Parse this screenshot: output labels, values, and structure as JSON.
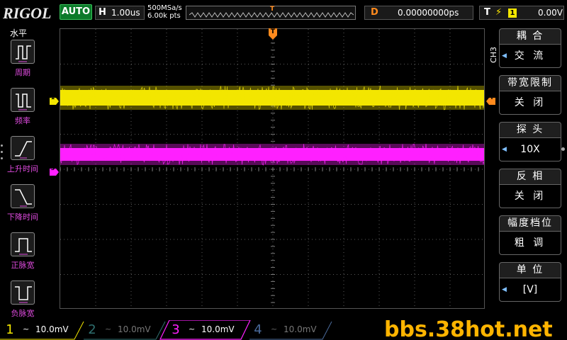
{
  "topbar": {
    "brand": "RIGOL",
    "run_mode": "AUTO",
    "horizontal": {
      "label": "H",
      "value": "1.00us"
    },
    "sample": {
      "rate": "500MSa/s",
      "points": "6.00k pts"
    },
    "memory_trigger_marker": "T",
    "delay": {
      "label": "D",
      "value": "0.00000000ps"
    },
    "trigger": {
      "label": "T",
      "edge_icon": "rising-edge-icon",
      "source": "1",
      "level": "0.00V"
    }
  },
  "left_menu": {
    "title": "水平",
    "items": [
      {
        "label": "周期",
        "icon": "period-measure-icon"
      },
      {
        "label": "频率",
        "icon": "frequency-measure-icon"
      },
      {
        "label": "上升时间",
        "icon": "rise-time-icon"
      },
      {
        "label": "下降时间",
        "icon": "fall-time-icon"
      },
      {
        "label": "正脉宽",
        "icon": "positive-width-icon"
      },
      {
        "label": "负脉宽",
        "icon": "negative-width-icon"
      }
    ]
  },
  "screen": {
    "trigger_position_marker": "T",
    "ch1_marker": "1",
    "ch3_marker": "3",
    "trigger_level_marker": "T"
  },
  "right_menu": {
    "channel_tag": "CH3",
    "items": [
      {
        "title": "耦 合",
        "value": "交 流",
        "has_arrow": true
      },
      {
        "title": "带宽限制",
        "value": "关 闭",
        "has_arrow": false
      },
      {
        "title": "探 头",
        "value": "10X",
        "has_arrow": true
      },
      {
        "title": "反 相",
        "value": "关 闭",
        "has_arrow": false
      },
      {
        "title": "幅度档位",
        "value": "粗 调",
        "has_arrow": false
      },
      {
        "title": "单 位",
        "value": "[V]",
        "has_arrow": true
      }
    ]
  },
  "channels": [
    {
      "num": "1",
      "coupling": "~",
      "scale": "10.0mV",
      "color": "#f3e600",
      "active": true
    },
    {
      "num": "2",
      "coupling": "~",
      "scale": "10.0mV",
      "color": "#2f8f8f",
      "active": false
    },
    {
      "num": "3",
      "coupling": "~",
      "scale": "10.0mV",
      "color": "#ff20ff",
      "active": true
    },
    {
      "num": "4",
      "coupling": "~",
      "scale": "10.0mV",
      "color": "#4a6a9a",
      "active": false
    }
  ],
  "watermark": "bbs.38hot.net",
  "colors": {
    "ch1": "#f3e600",
    "ch3": "#ff20ff",
    "trigger": "#ff8a1d",
    "auto": "#0c7a2a"
  }
}
